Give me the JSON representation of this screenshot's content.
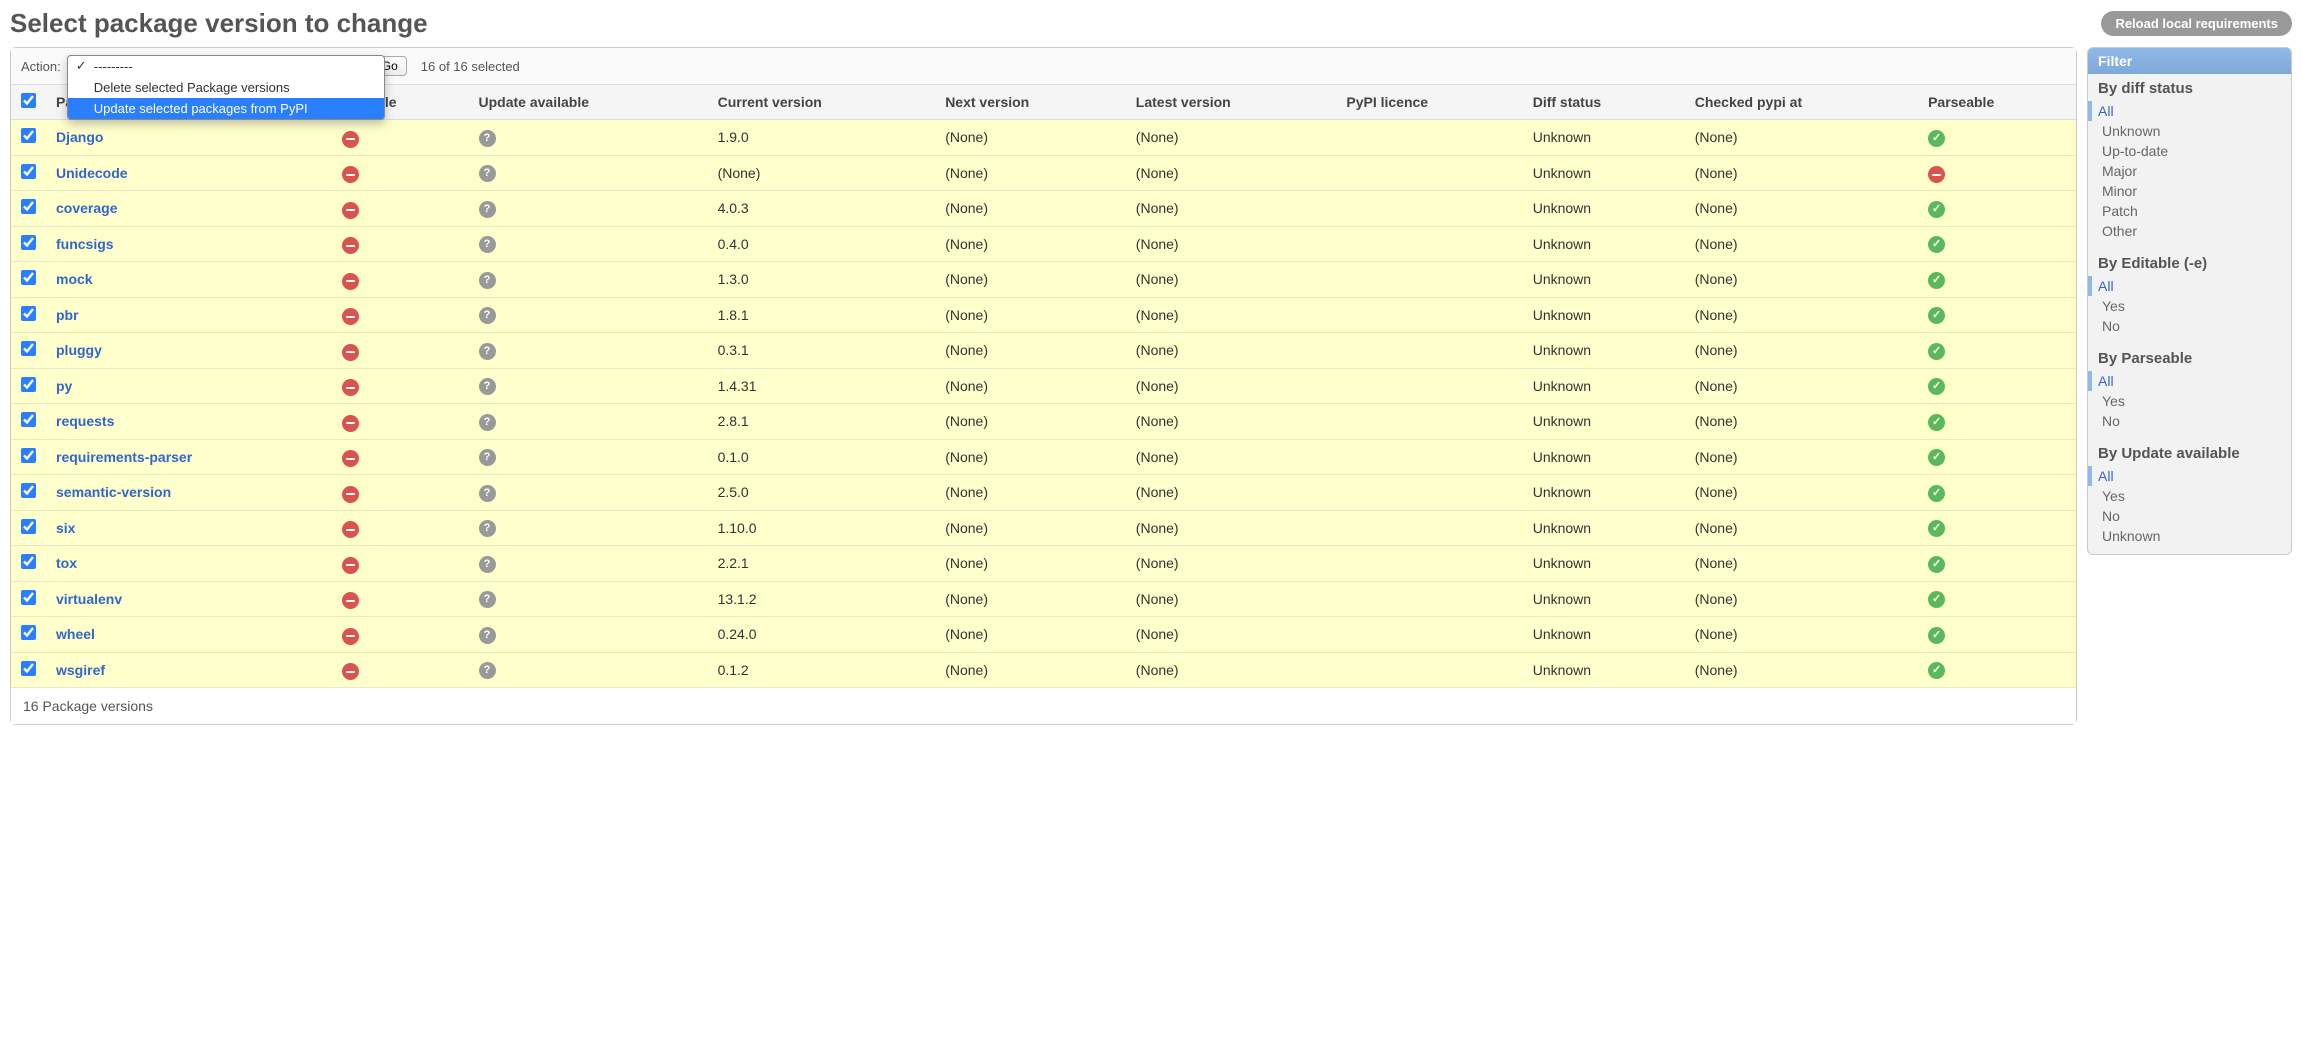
{
  "page": {
    "title": "Select package version to change",
    "reload_btn": "Reload local requirements",
    "footer": "16 Package versions"
  },
  "actions": {
    "label": "Action:",
    "go": "Go",
    "selection": "16 of 16 selected",
    "options": [
      {
        "label": "---------",
        "checked": true,
        "highlighted": false
      },
      {
        "label": "Delete selected Package versions",
        "checked": false,
        "highlighted": false
      },
      {
        "label": "Update selected packages from PyPI",
        "checked": false,
        "highlighted": true
      }
    ]
  },
  "columns": [
    "",
    "Package",
    "Editable",
    "Update available",
    "Current version",
    "Next version",
    "Latest version",
    "PyPI licence",
    "Diff status",
    "Checked pypi at",
    "Parseable"
  ],
  "rows": [
    {
      "pkg": "Django",
      "cur": "1.9.0",
      "next": "(None)",
      "latest": "(None)",
      "lic": "",
      "diff": "Unknown",
      "chk": "(None)",
      "parse": true
    },
    {
      "pkg": "Unidecode",
      "cur": "(None)",
      "next": "(None)",
      "latest": "(None)",
      "lic": "",
      "diff": "Unknown",
      "chk": "(None)",
      "parse": false
    },
    {
      "pkg": "coverage",
      "cur": "4.0.3",
      "next": "(None)",
      "latest": "(None)",
      "lic": "",
      "diff": "Unknown",
      "chk": "(None)",
      "parse": true
    },
    {
      "pkg": "funcsigs",
      "cur": "0.4.0",
      "next": "(None)",
      "latest": "(None)",
      "lic": "",
      "diff": "Unknown",
      "chk": "(None)",
      "parse": true
    },
    {
      "pkg": "mock",
      "cur": "1.3.0",
      "next": "(None)",
      "latest": "(None)",
      "lic": "",
      "diff": "Unknown",
      "chk": "(None)",
      "parse": true
    },
    {
      "pkg": "pbr",
      "cur": "1.8.1",
      "next": "(None)",
      "latest": "(None)",
      "lic": "",
      "diff": "Unknown",
      "chk": "(None)",
      "parse": true
    },
    {
      "pkg": "pluggy",
      "cur": "0.3.1",
      "next": "(None)",
      "latest": "(None)",
      "lic": "",
      "diff": "Unknown",
      "chk": "(None)",
      "parse": true
    },
    {
      "pkg": "py",
      "cur": "1.4.31",
      "next": "(None)",
      "latest": "(None)",
      "lic": "",
      "diff": "Unknown",
      "chk": "(None)",
      "parse": true
    },
    {
      "pkg": "requests",
      "cur": "2.8.1",
      "next": "(None)",
      "latest": "(None)",
      "lic": "",
      "diff": "Unknown",
      "chk": "(None)",
      "parse": true
    },
    {
      "pkg": "requirements-parser",
      "cur": "0.1.0",
      "next": "(None)",
      "latest": "(None)",
      "lic": "",
      "diff": "Unknown",
      "chk": "(None)",
      "parse": true
    },
    {
      "pkg": "semantic-version",
      "cur": "2.5.0",
      "next": "(None)",
      "latest": "(None)",
      "lic": "",
      "diff": "Unknown",
      "chk": "(None)",
      "parse": true
    },
    {
      "pkg": "six",
      "cur": "1.10.0",
      "next": "(None)",
      "latest": "(None)",
      "lic": "",
      "diff": "Unknown",
      "chk": "(None)",
      "parse": true
    },
    {
      "pkg": "tox",
      "cur": "2.2.1",
      "next": "(None)",
      "latest": "(None)",
      "lic": "",
      "diff": "Unknown",
      "chk": "(None)",
      "parse": true
    },
    {
      "pkg": "virtualenv",
      "cur": "13.1.2",
      "next": "(None)",
      "latest": "(None)",
      "lic": "",
      "diff": "Unknown",
      "chk": "(None)",
      "parse": true
    },
    {
      "pkg": "wheel",
      "cur": "0.24.0",
      "next": "(None)",
      "latest": "(None)",
      "lic": "",
      "diff": "Unknown",
      "chk": "(None)",
      "parse": true
    },
    {
      "pkg": "wsgiref",
      "cur": "0.1.2",
      "next": "(None)",
      "latest": "(None)",
      "lic": "",
      "diff": "Unknown",
      "chk": "(None)",
      "parse": true
    }
  ],
  "filters": {
    "title": "Filter",
    "groups": [
      {
        "title": "By diff status",
        "opts": [
          "All",
          "Unknown",
          "Up-to-date",
          "Major",
          "Minor",
          "Patch",
          "Other"
        ],
        "active": "All"
      },
      {
        "title": "By Editable (-e)",
        "opts": [
          "All",
          "Yes",
          "No"
        ],
        "active": "All"
      },
      {
        "title": "By Parseable",
        "opts": [
          "All",
          "Yes",
          "No"
        ],
        "active": "All"
      },
      {
        "title": "By Update available",
        "opts": [
          "All",
          "Yes",
          "No",
          "Unknown"
        ],
        "active": "All"
      }
    ]
  }
}
